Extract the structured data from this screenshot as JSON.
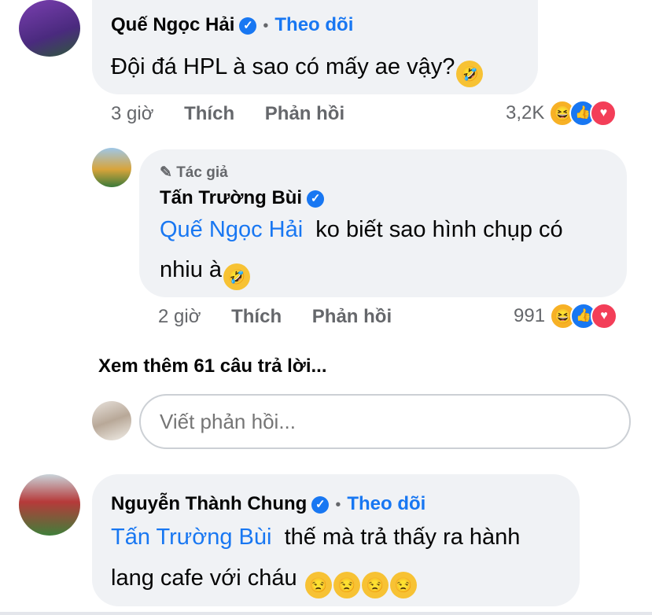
{
  "comment1": {
    "name": "Quế Ngọc Hải",
    "follow": "Theo dõi",
    "text": "Đội đá HPL à sao có mấy ae vậy?",
    "emoji": "🤣",
    "time": "3 giờ",
    "like": "Thích",
    "reply": "Phản hồi",
    "reaction_count": "3,2K"
  },
  "reply1": {
    "badge": "Tác giả",
    "name": "Tấn Trường Bùi",
    "mention": "Quế Ngọc Hải",
    "text_line1": "ko biết sao hình chụp có",
    "text_line2": "nhiu à",
    "emoji": "🤣",
    "time": "2 giờ",
    "like": "Thích",
    "reply": "Phản hồi",
    "reaction_count": "991"
  },
  "view_more": "Xem thêm 61 câu trả lời...",
  "reply_input": {
    "placeholder": "Viết phản hồi..."
  },
  "comment2": {
    "name": "Nguyễn Thành Chung",
    "follow": "Theo dõi",
    "mention": "Tấn Trường Bùi",
    "text_line1": "thế mà trả thấy ra hành",
    "text_line2": "lang cafe với cháu",
    "emojis": [
      "😒",
      "😒",
      "😒",
      "😒"
    ]
  },
  "colors": {
    "accent": "#1877f2",
    "bubble": "#f0f2f5",
    "muted": "#65676b"
  },
  "icons": [
    "verified-icon",
    "pen-icon",
    "haha-reaction-icon",
    "like-reaction-icon",
    "love-reaction-icon"
  ]
}
